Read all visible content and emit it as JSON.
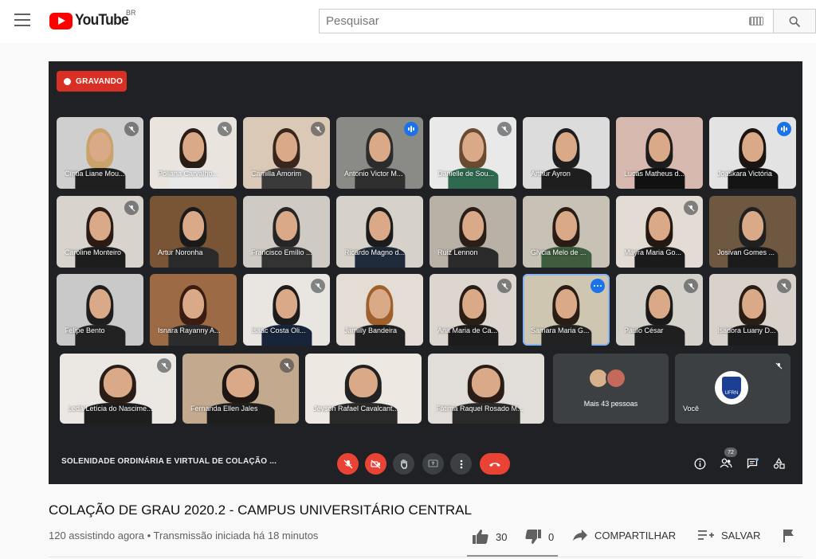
{
  "header": {
    "logo_text": "YouTube",
    "country_code": "BR",
    "search_placeholder": "Pesquisar"
  },
  "meeting": {
    "recording_label": "GRAVANDO",
    "title": "SOLENIDADE ORDINÁRIA E VIRTUAL DE COLAÇÃO ...",
    "participant_count": "72",
    "more_people_label": "Mais 43 pessoas",
    "self_label": "Você",
    "self_avatar_text": "UFRN",
    "participants": [
      {
        "name": "Cíntia Liane Mou...",
        "status": "muted",
        "bg": "#cfcfcf",
        "hair": "#c9a36a",
        "shirt": "#1f1f1f"
      },
      {
        "name": "Poliana Carvalho...",
        "status": "muted",
        "bg": "#e9e4de",
        "hair": "#2a1d16",
        "shirt": "#e8e8e8"
      },
      {
        "name": "Camilla Amorim",
        "status": "muted",
        "bg": "#d9c9b6",
        "hair": "#3a261c",
        "shirt": "#3a3a3a"
      },
      {
        "name": "Antonio Victor M...",
        "status": "speaking",
        "bg": "#8a8a86",
        "hair": "#2c2c2c",
        "shirt": "#2f2f2f"
      },
      {
        "name": "Danielle de Sou...",
        "status": "muted",
        "bg": "#e9e9e9",
        "hair": "#6a4a30",
        "shirt": "#2d6a4f"
      },
      {
        "name": "Arthur Ayron",
        "status": "none",
        "bg": "#dcdcdc",
        "hair": "#1e1e1e",
        "shirt": "#1e1e1e"
      },
      {
        "name": "Lucas Matheus d...",
        "status": "none",
        "bg": "#d8b9b0",
        "hair": "#1d1d1d",
        "shirt": "#111111"
      },
      {
        "name": "Joaskara Victória",
        "status": "speaking",
        "bg": "#e3e3e3",
        "hair": "#1b1410",
        "shirt": "#141414"
      },
      {
        "name": "Caroline Monteiro",
        "status": "muted",
        "bg": "#d8d3cd",
        "hair": "#2a1c14",
        "shirt": "#1d1d1d"
      },
      {
        "name": "Artur Noronha",
        "status": "none",
        "bg": "#7a5535",
        "hair": "#1a1a1a",
        "shirt": "#2a2a2a"
      },
      {
        "name": "Francisco Emílio ...",
        "status": "none",
        "bg": "#cfcac3",
        "hair": "#262626",
        "shirt": "#333333"
      },
      {
        "name": "Ricardo Magno d...",
        "status": "none",
        "bg": "#d7d2c9",
        "hair": "#1c1c1c",
        "shirt": "#1f2a3a"
      },
      {
        "name": "Ruiz Lennon",
        "status": "none",
        "bg": "#b9b1a6",
        "hair": "#2a1f18",
        "shirt": "#2a2a2a"
      },
      {
        "name": "Glycia Melo de ...",
        "status": "none",
        "bg": "#c8c2b6",
        "hair": "#2a1d16",
        "shirt": "#3e5c3e"
      },
      {
        "name": "Mayra Maria Go...",
        "status": "muted",
        "bg": "#e2dcd4",
        "hair": "#241812",
        "shirt": "#1a1a1a"
      },
      {
        "name": "Josivan Gomes ...",
        "status": "none",
        "bg": "#6f5842",
        "hair": "#202020",
        "shirt": "#1b1b1b"
      },
      {
        "name": "Felipe Bento",
        "status": "none",
        "bg": "#c9c9c9",
        "hair": "#1e1e1e",
        "shirt": "#222222"
      },
      {
        "name": "Isnara Rayanny A...",
        "status": "none",
        "bg": "#9c6a45",
        "hair": "#3a1c10",
        "shirt": "#2c2c2c"
      },
      {
        "name": "Isaac Costa Oli...",
        "status": "muted",
        "bg": "#e9e6e2",
        "hair": "#1c1c1c",
        "shirt": "#18243a"
      },
      {
        "name": "Jamilly Bandeira",
        "status": "none",
        "bg": "#e4ddd5",
        "hair": "#a0602e",
        "shirt": "#202020"
      },
      {
        "name": "Ana Maria de Ca...",
        "status": "muted",
        "bg": "#dcd6ce",
        "hair": "#2a1d16",
        "shirt": "#1c1c1c"
      },
      {
        "name": "Samara Maria G...",
        "status": "more",
        "bg": "#cfc6b2",
        "hair": "#2a1d16",
        "shirt": "#222222"
      },
      {
        "name": "Paulo César",
        "status": "muted",
        "bg": "#d4d0ca",
        "hair": "#1a1a1a",
        "shirt": "#1f1f1f"
      },
      {
        "name": "Isadora Luany D...",
        "status": "muted",
        "bg": "#d8d2ca",
        "hair": "#2a1d16",
        "shirt": "#1c1c1c"
      },
      {
        "name": "Ledá Letícia do Nascime...",
        "status": "muted",
        "bg": "#ebe8e4",
        "hair": "#2a1d16",
        "shirt": "#1e1e1e"
      },
      {
        "name": "Fernanda Ellen Jales",
        "status": "muted",
        "bg": "#c3a98e",
        "hair": "#1e1612",
        "shirt": "#1e1e1e"
      },
      {
        "name": "Jeyson Rafael Cavalcant...",
        "status": "none",
        "bg": "#ede8e2",
        "hair": "#222222",
        "shirt": "#2a2a2a"
      },
      {
        "name": "Fátima Raquel Rosado M...",
        "status": "none",
        "bg": "#e1ddd8",
        "hair": "#2a1d16",
        "shirt": "#2a2a2a"
      }
    ]
  },
  "video": {
    "title": "COLAÇÃO DE GRAU 2020.2 - CAMPUS UNIVERSITÁRIO CENTRAL",
    "viewers": "120 assistindo agora",
    "separator": " • ",
    "started": "Transmissão iniciada há 18 minutos",
    "likes": "30",
    "dislikes": "0",
    "share_label": "COMPARTILHAR",
    "save_label": "SALVAR"
  },
  "colors": {
    "brand_red": "#ff0000",
    "meet_red": "#ea4335",
    "meet_blue": "#1a73e8",
    "meet_bg": "#202124"
  }
}
